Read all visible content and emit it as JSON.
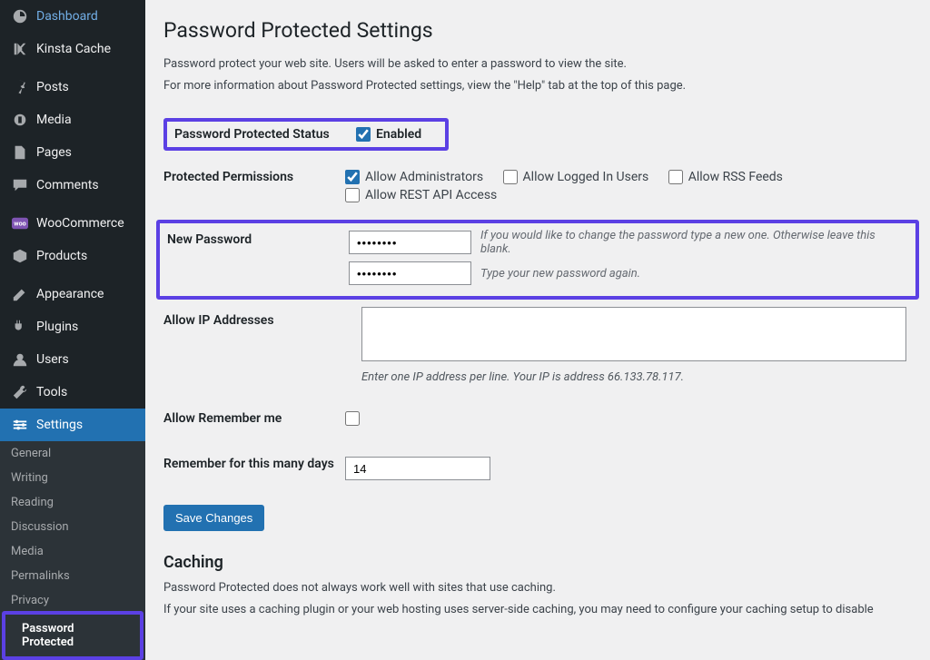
{
  "sidebar": {
    "items": [
      {
        "label": "Dashboard"
      },
      {
        "label": "Kinsta Cache"
      },
      {
        "label": "Posts"
      },
      {
        "label": "Media"
      },
      {
        "label": "Pages"
      },
      {
        "label": "Comments"
      },
      {
        "label": "WooCommerce"
      },
      {
        "label": "Products"
      },
      {
        "label": "Appearance"
      },
      {
        "label": "Plugins"
      },
      {
        "label": "Users"
      },
      {
        "label": "Tools"
      },
      {
        "label": "Settings"
      }
    ],
    "subitems": [
      {
        "label": "General"
      },
      {
        "label": "Writing"
      },
      {
        "label": "Reading"
      },
      {
        "label": "Discussion"
      },
      {
        "label": "Media"
      },
      {
        "label": "Permalinks"
      },
      {
        "label": "Privacy"
      },
      {
        "label": "Password Protected"
      }
    ]
  },
  "page": {
    "title": "Password Protected Settings",
    "intro1": "Password protect your web site. Users will be asked to enter a password to view the site.",
    "intro2": "For more information about Password Protected settings, view the \"Help\" tab at the top of this page.",
    "save": "Save Changes",
    "caching_heading": "Caching",
    "caching_p1": "Password Protected does not always work well with sites that use caching.",
    "caching_p2": "If your site uses a caching plugin or your web hosting uses server-side caching, you may need to configure your caching setup to disable caching for the Passw"
  },
  "fields": {
    "status_label": "Password Protected Status",
    "enabled_label": "Enabled",
    "permissions_label": "Protected Permissions",
    "perm_admin": "Allow Administrators",
    "perm_logged": "Allow Logged In Users",
    "perm_rss": "Allow RSS Feeds",
    "perm_rest": "Allow REST API Access",
    "newpw_label": "New Password",
    "newpw_value": "••••••••",
    "newpw_value2": "••••••••",
    "newpw_hint1": "If you would like to change the password type a new one. Otherwise leave this blank.",
    "newpw_hint2": "Type your new password again.",
    "ip_label": "Allow IP Addresses",
    "ip_hint": "Enter one IP address per line. Your IP is address 66.133.78.117.",
    "remember_label": "Allow Remember me",
    "remember_days_label": "Remember for this many days",
    "remember_days_value": "14"
  }
}
